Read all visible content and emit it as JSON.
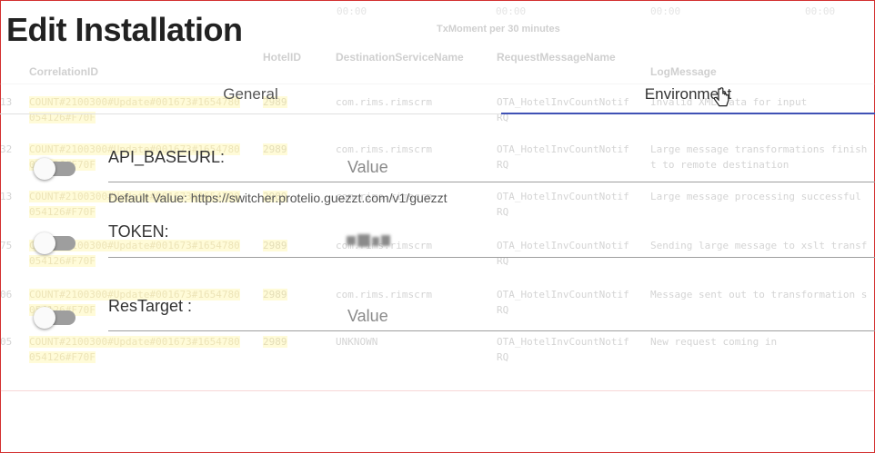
{
  "dialog": {
    "title": "Edit Installation",
    "tabs": [
      {
        "label": "General",
        "selected": false
      },
      {
        "label": "Environment",
        "selected": true
      }
    ],
    "fields": [
      {
        "label": "API_BASEURL:",
        "placeholder": "Value",
        "value": "",
        "enabled": false,
        "hint": "Default Value: https://switcher.protelio.guezzt.com/v1/guezzt"
      },
      {
        "label": "TOKEN:",
        "placeholder": "",
        "value": "",
        "value_obscured": true,
        "enabled": false,
        "hint": ""
      },
      {
        "label": "ResTarget :",
        "placeholder": "Value",
        "value": "",
        "enabled": false,
        "hint": ""
      }
    ],
    "colors": {
      "accent": "#3f51b5",
      "toggle_off": "#9e9e9e",
      "frame": "#d32f2f"
    }
  },
  "background": {
    "chart_title": "TxMoment per 30 minutes",
    "top_ticks": [
      "00:00",
      "00:00",
      "00:00",
      "00:00"
    ],
    "columns": [
      "CorrelationID",
      "HotelID",
      "DestinationServiceName",
      "RequestMessageName",
      "LogMessage"
    ],
    "rows": [
      {
        "idx": "13",
        "corr1": "COUNT#2100300#Update#001673#1654780",
        "corr2": "054126#F70F",
        "hotel": "2989",
        "dest": "com.rims.rimscrm",
        "req1": "OTA_HotelInvCountNotif",
        "req2": "RQ",
        "log1": "Invalid XML data for input",
        "log2": ""
      },
      {
        "idx": "32",
        "corr1": "COUNT#2100300#Update#001673#1654780",
        "corr2": "054126#F70F",
        "hotel": "2989",
        "dest": "com.rims.rimscrm",
        "req1": "OTA_HotelInvCountNotif",
        "req2": "RQ",
        "log1": "Large message transformations finish",
        "log2": "t to remote destination"
      },
      {
        "idx": "13",
        "corr1": "COUNT#2100300#Update#001673#1654780",
        "corr2": "054126#F70F",
        "hotel": "2989",
        "dest": "com.rims.rimscrm",
        "req1": "OTA_HotelInvCountNotif",
        "req2": "RQ",
        "log1": "Large message processing successful",
        "log2": ""
      },
      {
        "idx": "75",
        "corr1": "COUNT#2100300#Update#001673#1654780",
        "corr2": "054126#F70F",
        "hotel": "2989",
        "dest": "com.rims.rimscrm",
        "req1": "OTA_HotelInvCountNotif",
        "req2": "RQ",
        "log1": "Sending large message to xslt transf",
        "log2": ""
      },
      {
        "idx": "06",
        "corr1": "COUNT#2100300#Update#001673#1654780",
        "corr2": "054126#F70F",
        "hotel": "2989",
        "dest": "com.rims.rimscrm",
        "req1": "OTA_HotelInvCountNotif",
        "req2": "RQ",
        "log1": "Message sent out to transformation s",
        "log2": ""
      },
      {
        "idx": "05",
        "corr1": "COUNT#2100300#Update#001673#1654780",
        "corr2": "054126#F70F",
        "hotel": "2989",
        "dest": "UNKNOWN",
        "req1": "OTA_HotelInvCountNotif",
        "req2": "RQ",
        "log1": "New request coming in",
        "log2": ""
      }
    ]
  }
}
